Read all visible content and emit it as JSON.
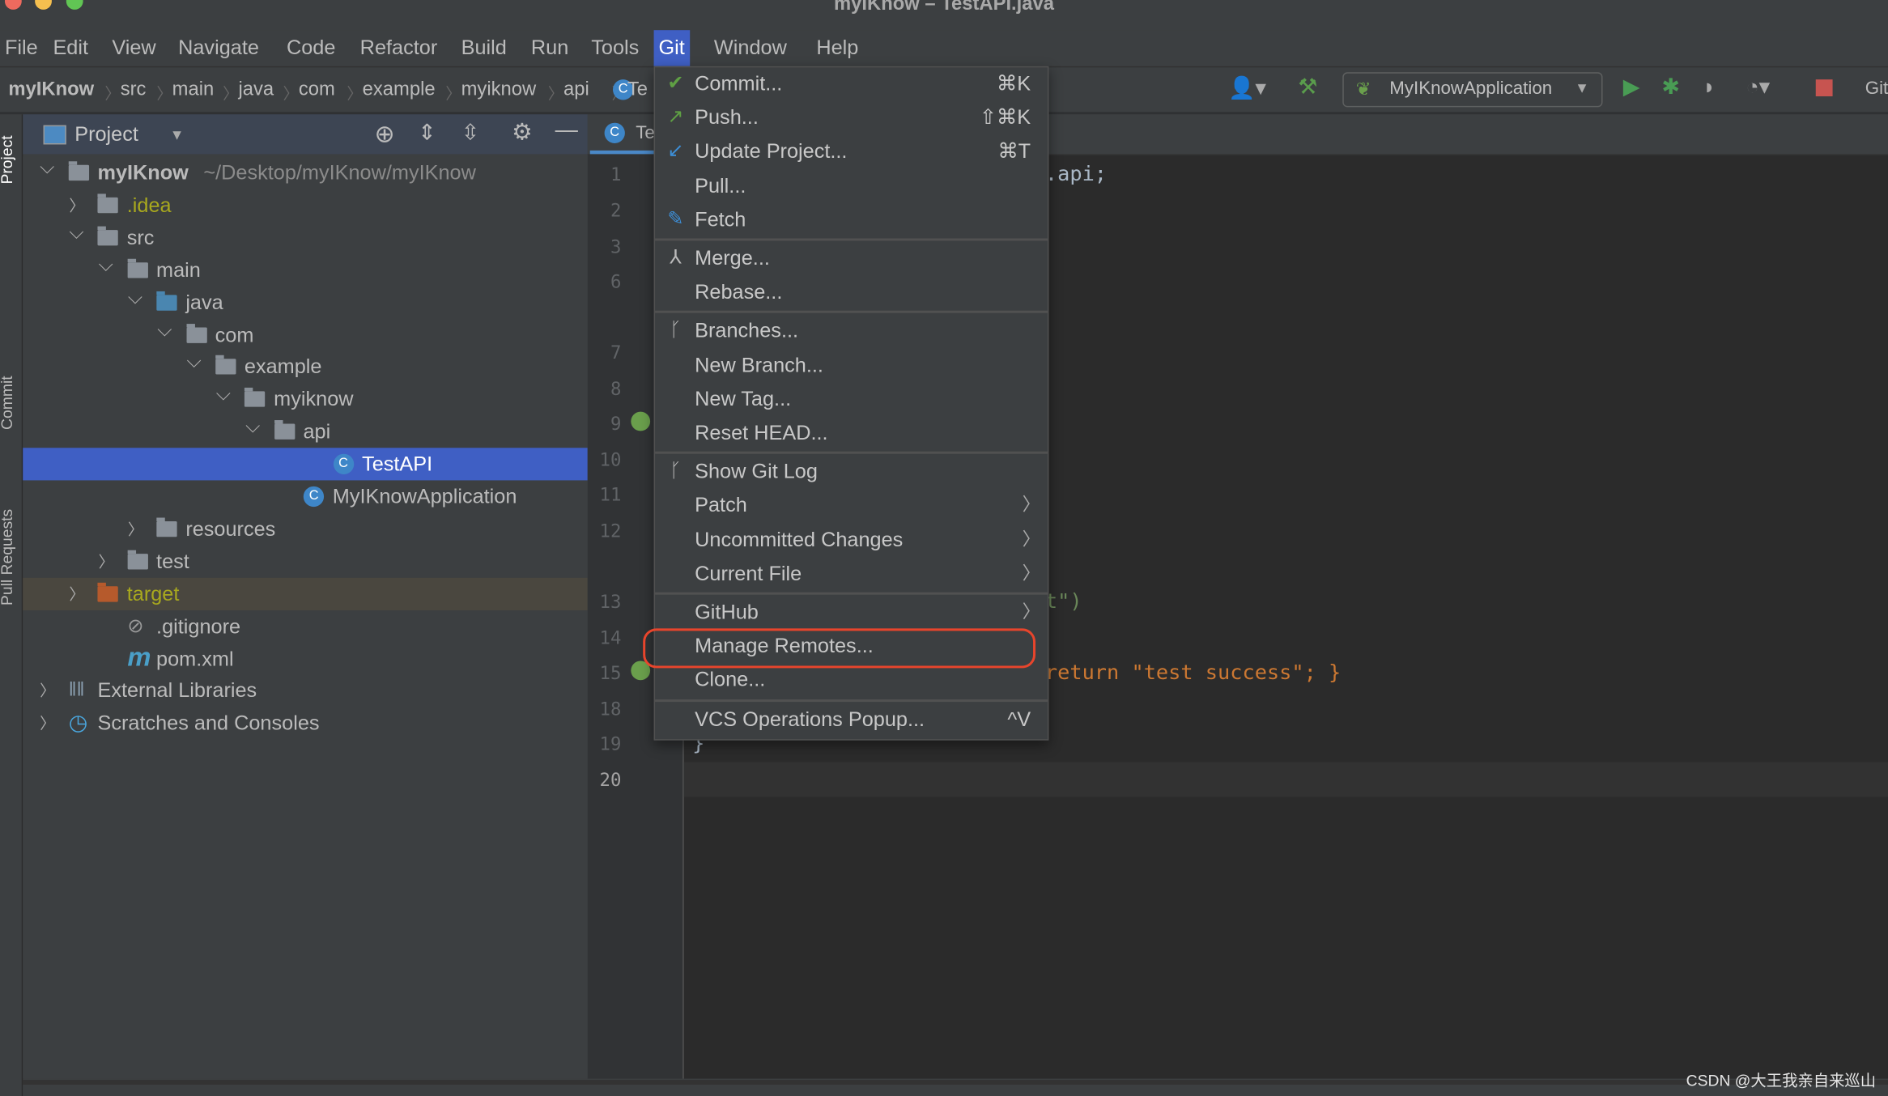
{
  "window": {
    "title": "myIKnow – TestAPI.java"
  },
  "menubar": {
    "items": [
      "File",
      "Edit",
      "View",
      "Navigate",
      "Code",
      "Refactor",
      "Build",
      "Run",
      "Tools",
      "Git",
      "Window",
      "Help"
    ],
    "active": "Git"
  },
  "breadcrumb": [
    "myIKnow",
    "src",
    "main",
    "java",
    "com",
    "example",
    "myiknow",
    "api",
    "Te"
  ],
  "toolbar": {
    "run_config": "MyIKnowApplication",
    "git_label": "Git"
  },
  "side_tabs": [
    "Project",
    "Commit",
    "Pull Requests"
  ],
  "project_panel": {
    "title": "Project"
  },
  "tree": [
    {
      "label": "myIKnow",
      "extra": "~/Desktop/myIKnow/myIKnow",
      "level": 0,
      "arrow": "down",
      "icon": "module-folder"
    },
    {
      "label": ".idea",
      "level": 1,
      "arrow": "right",
      "icon": "folder",
      "color": "#a8a81e"
    },
    {
      "label": "src",
      "level": 1,
      "arrow": "down",
      "icon": "folder"
    },
    {
      "label": "main",
      "level": 2,
      "arrow": "down",
      "icon": "folder"
    },
    {
      "label": "java",
      "level": 3,
      "arrow": "down",
      "icon": "source-folder"
    },
    {
      "label": "com",
      "level": 4,
      "arrow": "down",
      "icon": "package"
    },
    {
      "label": "example",
      "level": 5,
      "arrow": "down",
      "icon": "package"
    },
    {
      "label": "myiknow",
      "level": 6,
      "arrow": "down",
      "icon": "package"
    },
    {
      "label": "api",
      "level": 7,
      "arrow": "down",
      "icon": "package"
    },
    {
      "label": "TestAPI",
      "level": 9,
      "arrow": "",
      "icon": "class",
      "selected": true
    },
    {
      "label": "MyIKnowApplication",
      "level": 8,
      "arrow": "",
      "icon": "spring-class"
    },
    {
      "label": "resources",
      "level": 3,
      "arrow": "right",
      "icon": "resources-folder"
    },
    {
      "label": "test",
      "level": 2,
      "arrow": "right",
      "icon": "folder"
    },
    {
      "label": "target",
      "level": 1,
      "arrow": "right",
      "icon": "excluded-folder",
      "color": "#a8a81e",
      "excluded": true
    },
    {
      "label": ".gitignore",
      "level": 2,
      "arrow": "",
      "icon": "ignore-file"
    },
    {
      "label": "pom.xml",
      "level": 2,
      "arrow": "",
      "icon": "maven"
    },
    {
      "label": "External Libraries",
      "level": 0,
      "arrow": "right",
      "icon": "libraries"
    },
    {
      "label": "Scratches and Consoles",
      "level": 0,
      "arrow": "right",
      "icon": "scratches"
    }
  ],
  "editor": {
    "tab": "Te",
    "line_numbers": [
      "1",
      "2",
      "3",
      "6",
      "7",
      "8",
      "9",
      "10",
      "11",
      "12",
      "13",
      "14",
      "15",
      "18",
      "19",
      "20"
    ],
    "current_line": "20",
    "code_fragments": [
      ".api;",
      "t\")",
      "return \"test success\"; }",
      "}"
    ]
  },
  "git_menu": [
    {
      "label": "Commit...",
      "shortcut": "⌘K",
      "icon": "check-icon"
    },
    {
      "label": "Push...",
      "shortcut": "⇧⌘K",
      "icon": "push-arrow-icon"
    },
    {
      "label": "Update Project...",
      "shortcut": "⌘T",
      "icon": "update-arrow-icon"
    },
    {
      "label": "Pull..."
    },
    {
      "label": "Fetch",
      "icon": "fetch-icon"
    },
    {
      "separator": true
    },
    {
      "label": "Merge...",
      "icon": "merge-icon"
    },
    {
      "label": "Rebase..."
    },
    {
      "separator": true
    },
    {
      "label": "Branches...",
      "icon": "branch-icon"
    },
    {
      "label": "New Branch..."
    },
    {
      "label": "New Tag..."
    },
    {
      "label": "Reset HEAD..."
    },
    {
      "separator": true
    },
    {
      "label": "Show Git Log",
      "icon": "git-log-icon"
    },
    {
      "label": "Patch",
      "submenu": true
    },
    {
      "label": "Uncommitted Changes",
      "submenu": true
    },
    {
      "label": "Current File",
      "submenu": true
    },
    {
      "separator": true
    },
    {
      "label": "GitHub",
      "submenu": true
    },
    {
      "label": "Manage Remotes...",
      "highlighted_annotation": true
    },
    {
      "label": "Clone..."
    },
    {
      "separator": true
    },
    {
      "label": "VCS Operations Popup...",
      "shortcut": "^V"
    }
  ],
  "colors": {
    "accent": "#3f5fc4",
    "annotation": "#e8452c",
    "editor_bg": "#2b2b2b",
    "panel_bg": "#3c3f41"
  },
  "watermark": "CSDN @大王我亲自来巡山"
}
